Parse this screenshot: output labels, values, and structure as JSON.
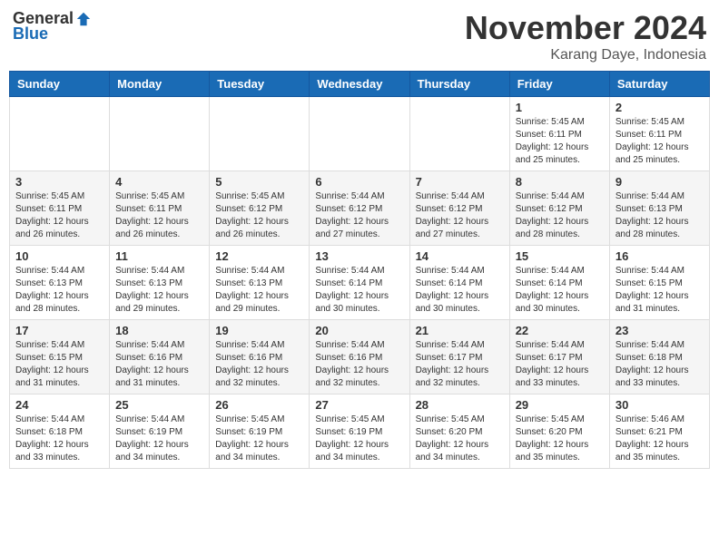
{
  "logo": {
    "general": "General",
    "blue": "Blue"
  },
  "title": "November 2024",
  "location": "Karang Daye, Indonesia",
  "days_header": [
    "Sunday",
    "Monday",
    "Tuesday",
    "Wednesday",
    "Thursday",
    "Friday",
    "Saturday"
  ],
  "weeks": [
    [
      {
        "day": "",
        "sunrise": "",
        "sunset": "",
        "daylight": ""
      },
      {
        "day": "",
        "sunrise": "",
        "sunset": "",
        "daylight": ""
      },
      {
        "day": "",
        "sunrise": "",
        "sunset": "",
        "daylight": ""
      },
      {
        "day": "",
        "sunrise": "",
        "sunset": "",
        "daylight": ""
      },
      {
        "day": "",
        "sunrise": "",
        "sunset": "",
        "daylight": ""
      },
      {
        "day": "1",
        "sunrise": "Sunrise: 5:45 AM",
        "sunset": "Sunset: 6:11 PM",
        "daylight": "Daylight: 12 hours and 25 minutes."
      },
      {
        "day": "2",
        "sunrise": "Sunrise: 5:45 AM",
        "sunset": "Sunset: 6:11 PM",
        "daylight": "Daylight: 12 hours and 25 minutes."
      }
    ],
    [
      {
        "day": "3",
        "sunrise": "Sunrise: 5:45 AM",
        "sunset": "Sunset: 6:11 PM",
        "daylight": "Daylight: 12 hours and 26 minutes."
      },
      {
        "day": "4",
        "sunrise": "Sunrise: 5:45 AM",
        "sunset": "Sunset: 6:11 PM",
        "daylight": "Daylight: 12 hours and 26 minutes."
      },
      {
        "day": "5",
        "sunrise": "Sunrise: 5:45 AM",
        "sunset": "Sunset: 6:12 PM",
        "daylight": "Daylight: 12 hours and 26 minutes."
      },
      {
        "day": "6",
        "sunrise": "Sunrise: 5:44 AM",
        "sunset": "Sunset: 6:12 PM",
        "daylight": "Daylight: 12 hours and 27 minutes."
      },
      {
        "day": "7",
        "sunrise": "Sunrise: 5:44 AM",
        "sunset": "Sunset: 6:12 PM",
        "daylight": "Daylight: 12 hours and 27 minutes."
      },
      {
        "day": "8",
        "sunrise": "Sunrise: 5:44 AM",
        "sunset": "Sunset: 6:12 PM",
        "daylight": "Daylight: 12 hours and 28 minutes."
      },
      {
        "day": "9",
        "sunrise": "Sunrise: 5:44 AM",
        "sunset": "Sunset: 6:13 PM",
        "daylight": "Daylight: 12 hours and 28 minutes."
      }
    ],
    [
      {
        "day": "10",
        "sunrise": "Sunrise: 5:44 AM",
        "sunset": "Sunset: 6:13 PM",
        "daylight": "Daylight: 12 hours and 28 minutes."
      },
      {
        "day": "11",
        "sunrise": "Sunrise: 5:44 AM",
        "sunset": "Sunset: 6:13 PM",
        "daylight": "Daylight: 12 hours and 29 minutes."
      },
      {
        "day": "12",
        "sunrise": "Sunrise: 5:44 AM",
        "sunset": "Sunset: 6:13 PM",
        "daylight": "Daylight: 12 hours and 29 minutes."
      },
      {
        "day": "13",
        "sunrise": "Sunrise: 5:44 AM",
        "sunset": "Sunset: 6:14 PM",
        "daylight": "Daylight: 12 hours and 30 minutes."
      },
      {
        "day": "14",
        "sunrise": "Sunrise: 5:44 AM",
        "sunset": "Sunset: 6:14 PM",
        "daylight": "Daylight: 12 hours and 30 minutes."
      },
      {
        "day": "15",
        "sunrise": "Sunrise: 5:44 AM",
        "sunset": "Sunset: 6:14 PM",
        "daylight": "Daylight: 12 hours and 30 minutes."
      },
      {
        "day": "16",
        "sunrise": "Sunrise: 5:44 AM",
        "sunset": "Sunset: 6:15 PM",
        "daylight": "Daylight: 12 hours and 31 minutes."
      }
    ],
    [
      {
        "day": "17",
        "sunrise": "Sunrise: 5:44 AM",
        "sunset": "Sunset: 6:15 PM",
        "daylight": "Daylight: 12 hours and 31 minutes."
      },
      {
        "day": "18",
        "sunrise": "Sunrise: 5:44 AM",
        "sunset": "Sunset: 6:16 PM",
        "daylight": "Daylight: 12 hours and 31 minutes."
      },
      {
        "day": "19",
        "sunrise": "Sunrise: 5:44 AM",
        "sunset": "Sunset: 6:16 PM",
        "daylight": "Daylight: 12 hours and 32 minutes."
      },
      {
        "day": "20",
        "sunrise": "Sunrise: 5:44 AM",
        "sunset": "Sunset: 6:16 PM",
        "daylight": "Daylight: 12 hours and 32 minutes."
      },
      {
        "day": "21",
        "sunrise": "Sunrise: 5:44 AM",
        "sunset": "Sunset: 6:17 PM",
        "daylight": "Daylight: 12 hours and 32 minutes."
      },
      {
        "day": "22",
        "sunrise": "Sunrise: 5:44 AM",
        "sunset": "Sunset: 6:17 PM",
        "daylight": "Daylight: 12 hours and 33 minutes."
      },
      {
        "day": "23",
        "sunrise": "Sunrise: 5:44 AM",
        "sunset": "Sunset: 6:18 PM",
        "daylight": "Daylight: 12 hours and 33 minutes."
      }
    ],
    [
      {
        "day": "24",
        "sunrise": "Sunrise: 5:44 AM",
        "sunset": "Sunset: 6:18 PM",
        "daylight": "Daylight: 12 hours and 33 minutes."
      },
      {
        "day": "25",
        "sunrise": "Sunrise: 5:44 AM",
        "sunset": "Sunset: 6:19 PM",
        "daylight": "Daylight: 12 hours and 34 minutes."
      },
      {
        "day": "26",
        "sunrise": "Sunrise: 5:45 AM",
        "sunset": "Sunset: 6:19 PM",
        "daylight": "Daylight: 12 hours and 34 minutes."
      },
      {
        "day": "27",
        "sunrise": "Sunrise: 5:45 AM",
        "sunset": "Sunset: 6:19 PM",
        "daylight": "Daylight: 12 hours and 34 minutes."
      },
      {
        "day": "28",
        "sunrise": "Sunrise: 5:45 AM",
        "sunset": "Sunset: 6:20 PM",
        "daylight": "Daylight: 12 hours and 34 minutes."
      },
      {
        "day": "29",
        "sunrise": "Sunrise: 5:45 AM",
        "sunset": "Sunset: 6:20 PM",
        "daylight": "Daylight: 12 hours and 35 minutes."
      },
      {
        "day": "30",
        "sunrise": "Sunrise: 5:46 AM",
        "sunset": "Sunset: 6:21 PM",
        "daylight": "Daylight: 12 hours and 35 minutes."
      }
    ]
  ]
}
